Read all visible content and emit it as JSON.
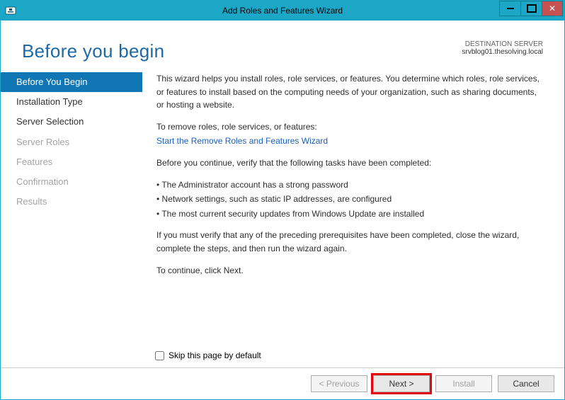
{
  "titlebar": {
    "title": "Add Roles and Features Wizard"
  },
  "header": {
    "page_title": "Before you begin"
  },
  "destination": {
    "label": "DESTINATION SERVER",
    "server": "srvblog01.thesolving.local"
  },
  "sidebar": [
    {
      "label": "Before You Begin",
      "state": "selected"
    },
    {
      "label": "Installation Type",
      "state": "enabled"
    },
    {
      "label": "Server Selection",
      "state": "enabled"
    },
    {
      "label": "Server Roles",
      "state": "disabled"
    },
    {
      "label": "Features",
      "state": "disabled"
    },
    {
      "label": "Confirmation",
      "state": "disabled"
    },
    {
      "label": "Results",
      "state": "disabled"
    }
  ],
  "content": {
    "intro": "This wizard helps you install roles, role services, or features. You determine which roles, role services, or features to install based on the computing needs of your organization, such as sharing documents, or hosting a website.",
    "remove_lead": "To remove roles, role services, or features:",
    "remove_link": "Start the Remove Roles and Features Wizard",
    "verify_lead": "Before you continue, verify that the following tasks have been completed:",
    "bullets": [
      "The Administrator account has a strong password",
      "Network settings, such as static IP addresses, are configured",
      "The most current security updates from Windows Update are installed"
    ],
    "close_note": "If you must verify that any of the preceding prerequisites have been completed, close the wizard, complete the steps, and then run the wizard again.",
    "continue": "To continue, click Next.",
    "skip_label": "Skip this page by default"
  },
  "footer": {
    "previous": "< Previous",
    "next": "Next >",
    "install": "Install",
    "cancel": "Cancel"
  }
}
